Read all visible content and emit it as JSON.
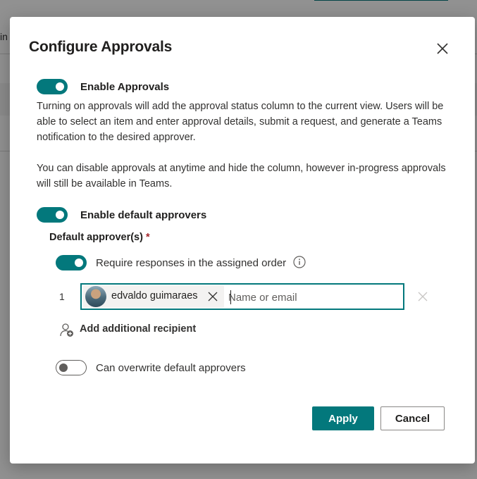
{
  "background": {
    "fragment_text": "in"
  },
  "dialog": {
    "title": "Configure Approvals",
    "close_icon": "close-icon",
    "enable_approvals": {
      "label": "Enable Approvals",
      "checked": true,
      "description_1": "Turning on approvals will add the approval status column to the current view. Users will be able to select an item and enter approval details, submit a request, and generate a Teams notification to the desired approver.",
      "description_2": "You can disable approvals at anytime and hide the column, however in-progress approvals will still be available in Teams."
    },
    "enable_default_approvers": {
      "label": "Enable default approvers",
      "checked": true
    },
    "default_approvers": {
      "label": "Default approver(s)",
      "required_mark": "*",
      "require_order": {
        "label": "Require responses in the assigned order",
        "checked": true,
        "info_icon": "info-icon"
      },
      "rows": [
        {
          "index": "1",
          "person": "edvaldo guimaraes",
          "input_placeholder": "Name or email"
        }
      ],
      "add_recipient_label": "Add additional recipient",
      "add_recipient_icon": "add-person-icon"
    },
    "can_overwrite": {
      "label": "Can overwrite default approvers",
      "checked": false
    },
    "buttons": {
      "apply": "Apply",
      "cancel": "Cancel"
    }
  },
  "colors": {
    "accent": "#03787c",
    "required": "#a4262c",
    "text": "#323130"
  }
}
